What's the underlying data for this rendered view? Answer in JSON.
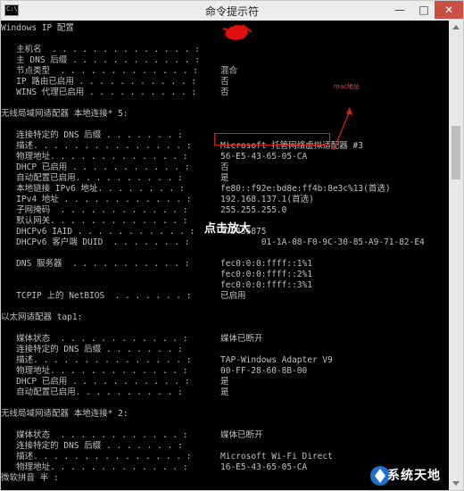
{
  "window": {
    "title": "命令提示符",
    "icon_label": "C:\\",
    "minimize_glyph": "—",
    "maximize_glyph": "□",
    "close_glyph": "✕"
  },
  "lines": [
    {
      "lbl": "Windows IP 配置",
      "dots": "",
      "val": ""
    },
    {
      "lbl": "",
      "dots": "",
      "val": ""
    },
    {
      "lbl": "   主机名  . . . . . . . . . . . . . . :",
      "dots": "",
      "val": ""
    },
    {
      "lbl": "   主 DNS 后缀 . . . . . . . . . . . . :",
      "dots": "",
      "val": ""
    },
    {
      "lbl": "   节点类型  . . . . . . . . . . . . . :",
      "dots": "",
      "val": "混合"
    },
    {
      "lbl": "   IP 路由已启用 . . . . . . . . . . . :",
      "dots": "",
      "val": "否"
    },
    {
      "lbl": "   WINS 代理已启用 . . . . . . . . . . :",
      "dots": "",
      "val": "否"
    },
    {
      "lbl": "",
      "dots": "",
      "val": ""
    },
    {
      "lbl": "无线局域网适配器 本地连接* 5:",
      "dots": "",
      "val": ""
    },
    {
      "lbl": "",
      "dots": "",
      "val": ""
    },
    {
      "lbl": "   连接特定的 DNS 后缀 . . . . . . . :",
      "dots": "",
      "val": ""
    },
    {
      "lbl": "   描述. . . . . . . . . . . . . . . :",
      "dots": "",
      "val": "Microsoft 托管网络虚拟适配器 #3"
    },
    {
      "lbl": "   物理地址. . . . . . . . . . . . . :",
      "dots": "",
      "val": "56-E5-43-65-05-CA"
    },
    {
      "lbl": "   DHCP 已启用 . . . . . . . . . . . :",
      "dots": "",
      "val": "否"
    },
    {
      "lbl": "   自动配置已启用. . . . . . . . . . :",
      "dots": "",
      "val": "是"
    },
    {
      "lbl": "   本地链接 IPv6 地址. . . . . . . . :",
      "dots": "",
      "val": "fe80::f92e:bd8e:ff4b:8e3c%13(首选)"
    },
    {
      "lbl": "   IPv4 地址 . . . . . . . . . . . . :",
      "dots": "",
      "val": "192.168.137.1(首选)"
    },
    {
      "lbl": "   子网掩码  . . . . . . . . . . . . :",
      "dots": "",
      "val": "255.255.255.0"
    },
    {
      "lbl": "   默认网关. . . . . . . . . . . . . :",
      "dots": "",
      "val": ""
    },
    {
      "lbl": "   DHCPv6 IAID . . . . . . . . . . . :",
      "dots": "",
      "val": "475456875"
    },
    {
      "lbl": "   DHCPv6 客户端 DUID  . . . . . . . :",
      "dots": "",
      "val": "        01-1A-08-F0-9C-30-85-A9-71-82-E4"
    },
    {
      "lbl": "",
      "dots": "",
      "val": ""
    },
    {
      "lbl": "   DNS 服务器  . . . . . . . . . . . :",
      "dots": "",
      "val": "fec0:0:0:ffff::1%1"
    },
    {
      "lbl": "",
      "dots": "",
      "val": "fec0:0:0:ffff::2%1"
    },
    {
      "lbl": "",
      "dots": "",
      "val": "fec0:0:0:ffff::3%1"
    },
    {
      "lbl": "   TCPIP 上的 NetBIOS  . . . . . . . :",
      "dots": "",
      "val": "已启用"
    },
    {
      "lbl": "",
      "dots": "",
      "val": ""
    },
    {
      "lbl": "以太网适配器 tap1:",
      "dots": "",
      "val": ""
    },
    {
      "lbl": "",
      "dots": "",
      "val": ""
    },
    {
      "lbl": "   媒体状态  . . . . . . . . . . . . :",
      "dots": "",
      "val": "媒体已断开"
    },
    {
      "lbl": "   连接特定的 DNS 后缀 . . . . . . . :",
      "dots": "",
      "val": ""
    },
    {
      "lbl": "   描述. . . . . . . . . . . . . . . :",
      "dots": "",
      "val": "TAP-Windows Adapter V9"
    },
    {
      "lbl": "   物理地址. . . . . . . . . . . . . :",
      "dots": "",
      "val": "00-FF-28-60-8B-00"
    },
    {
      "lbl": "   DHCP 已启用 . . . . . . . . . . . :",
      "dots": "",
      "val": "是"
    },
    {
      "lbl": "   自动配置已启用. . . . . . . . . . :",
      "dots": "",
      "val": "是"
    },
    {
      "lbl": "",
      "dots": "",
      "val": ""
    },
    {
      "lbl": "无线局域网适配器 本地连接* 2:",
      "dots": "",
      "val": ""
    },
    {
      "lbl": "",
      "dots": "",
      "val": ""
    },
    {
      "lbl": "   媒体状态  . . . . . . . . . . . . :",
      "dots": "",
      "val": "媒体已断开"
    },
    {
      "lbl": "   连接特定的 DNS 后缀 . . . . . . . :",
      "dots": "",
      "val": ""
    },
    {
      "lbl": "   描述. . . . . . . . . . . . . . . :",
      "dots": "",
      "val": "Microsoft Wi-Fi Direct"
    },
    {
      "lbl": "   物理地址. . . . . . . . . . . . . :",
      "dots": "",
      "val": "16-E5-43-65-05-CA"
    },
    {
      "lbl": "微软拼音 半 :",
      "dots": "",
      "val": ""
    }
  ],
  "annotation": {
    "label": "mac地址",
    "color": "#d02020"
  },
  "overlay": {
    "zoom_text": "点击放大"
  },
  "watermark": {
    "brand": "系统天地"
  },
  "colors": {
    "console_bg": "#000000",
    "console_text": "#c0c0c0",
    "highlight": "#d02020"
  }
}
